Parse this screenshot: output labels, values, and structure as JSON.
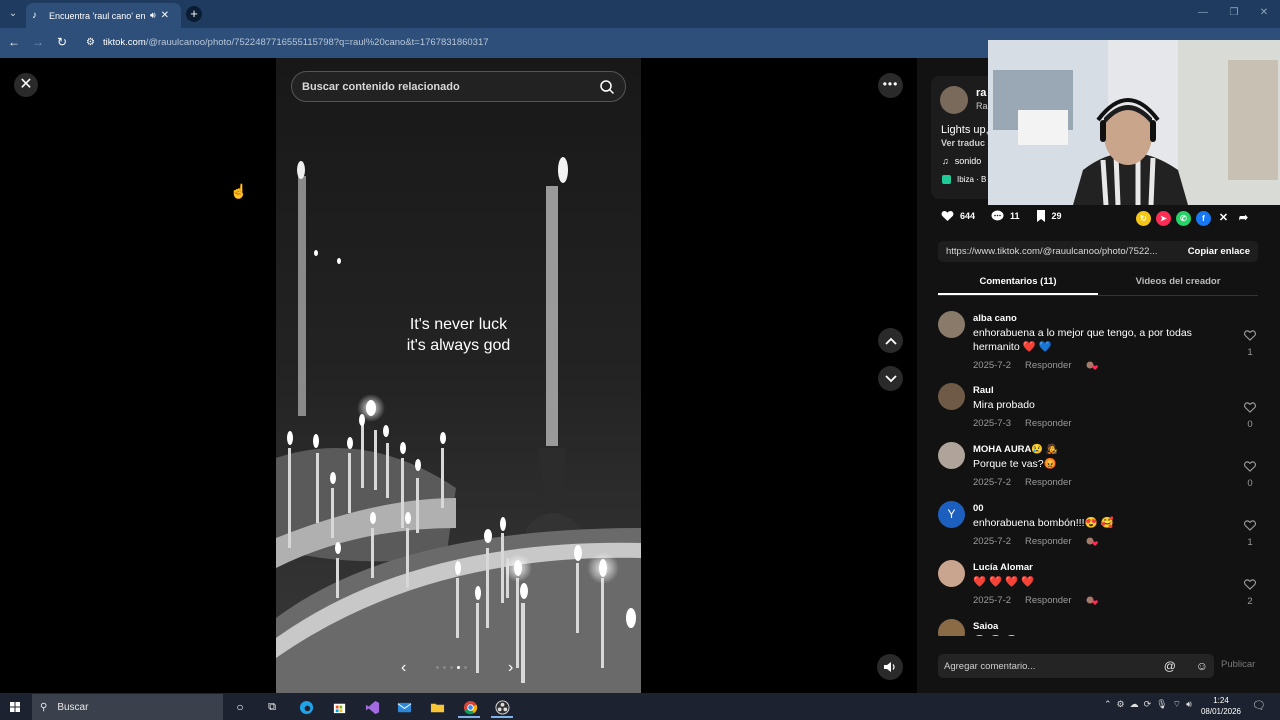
{
  "browser": {
    "tab_title": "Encuentra 'raul cano' en TikTok",
    "url_domain": "tiktok.com",
    "url_path": "/@rauulcanoo/photo/7522487716555115798?q=raul%20cano&t=1767831860317"
  },
  "viewer": {
    "search_placeholder": "Buscar contenido relacionado",
    "overlay_line1": "It's never luck",
    "overlay_line2": "it's always god",
    "slides_total": 5,
    "slide_active": 4
  },
  "post": {
    "author_name": "ra",
    "author_sub": "Ra",
    "caption": "Lights up,",
    "see_translation": "Ver traduc",
    "music": "sonido",
    "location": "Ibiza · B",
    "likes": "644",
    "comments_count": "11",
    "saves": "29",
    "link": "https://www.tiktok.com/@rauulcanoo/photo/7522...",
    "copy_link_label": "Copiar enlace"
  },
  "tabs": {
    "comments_label": "Comentarios (11)",
    "creator_videos_label": "Videos del creador"
  },
  "comments": [
    {
      "user": "alba cano",
      "text": "enhorabuena a lo mejor que tengo, a por todas hermanito ❤️ 💙",
      "date": "2025-7-2",
      "reply": "Responder",
      "likes": "1",
      "avatar_color": "#8a7a6a",
      "creator_liked": true
    },
    {
      "user": "Raul",
      "text": "Mira probado",
      "date": "2025-7-3",
      "reply": "Responder",
      "likes": "0",
      "avatar_color": "#6f5a48",
      "creator_liked": false
    },
    {
      "user": "MOHA AURA😢 🧑‍🎤",
      "text": "Porque te vas?😡",
      "date": "2025-7-2",
      "reply": "Responder",
      "likes": "0",
      "avatar_color": "#b0a49a",
      "creator_liked": false
    },
    {
      "user": "00",
      "text": "enhorabuena bombón!!!😍 🥰",
      "date": "2025-7-2",
      "reply": "Responder",
      "likes": "1",
      "avatar_color": "#1d5fbf",
      "avatar_letter": "Y",
      "creator_liked": true
    },
    {
      "user": "Lucía Alomar",
      "text": "❤️ ❤️ ❤️ ❤️",
      "date": "2025-7-2",
      "reply": "Responder",
      "likes": "2",
      "avatar_color": "#c9a48e",
      "creator_liked": true
    },
    {
      "user": "Saioa",
      "text": "😢 😢 😢",
      "date": "",
      "reply": "",
      "likes": "",
      "avatar_color": "#8a6b45",
      "creator_liked": false
    }
  ],
  "composer": {
    "placeholder": "Agregar comentario...",
    "publish_label": "Publicar"
  },
  "taskbar": {
    "search_label": "Buscar",
    "time": "1:24",
    "date": "08/01/2026"
  },
  "colors": {
    "tiktok_red": "#fe2c55",
    "chrome_blue": "#1f3b5f"
  }
}
